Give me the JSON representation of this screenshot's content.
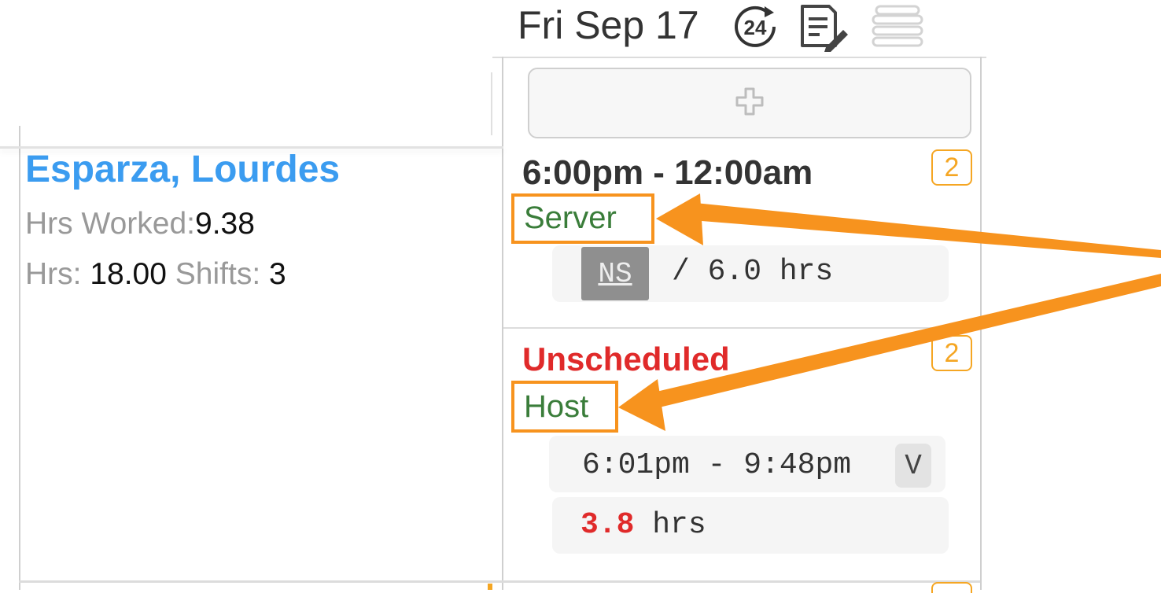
{
  "header": {
    "date": "Fri Sep 17",
    "clock_badge": "24",
    "icons": [
      "24-hour-clock-icon",
      "notes-edit-icon",
      "stack-icon"
    ]
  },
  "employee": {
    "name": "Esparza, Lourdes",
    "hrs_worked_label": "Hrs Worked:",
    "hrs_worked_value": "9.38",
    "hrs_label": "Hrs:",
    "hrs_value": "18.00",
    "shifts_label": "Shifts:",
    "shifts_value": "3"
  },
  "day_column": {
    "add_icon": "plus-icon",
    "shifts": [
      {
        "time": "6:00pm - 12:00am",
        "role": "Server",
        "badge": "2",
        "status": "NS",
        "hours": "/ 6.0 hrs"
      },
      {
        "time": "Unscheduled",
        "role": "Host",
        "badge": "2",
        "punch": "6:01pm - 9:48pm",
        "punch_flag": "V",
        "hours_value": "3.8",
        "hours_unit": "hrs"
      }
    ]
  },
  "colors": {
    "name_blue": "#3b9cf0",
    "role_green": "#3a7d3a",
    "badge_orange": "#f5a623",
    "alert_red": "#e02a2a",
    "annotation_orange": "#f7931e"
  }
}
